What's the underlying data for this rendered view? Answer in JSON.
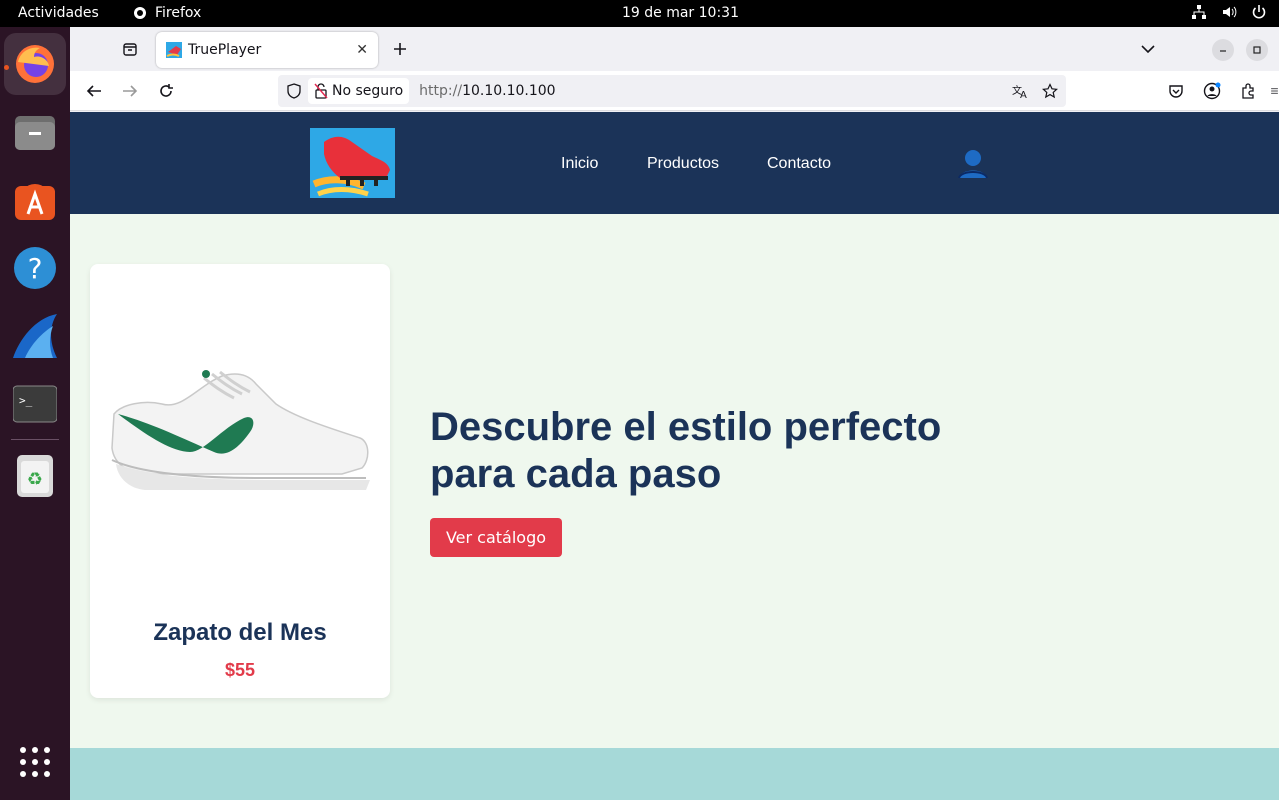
{
  "topbar": {
    "activities": "Actividades",
    "app_name": "Firefox",
    "clock": "19 de mar  10:31"
  },
  "browser": {
    "tab_title": "TruePlayer",
    "url_security": "No seguro",
    "url_protocol": "http://",
    "url_host": "10.10.10.100"
  },
  "site": {
    "nav": [
      "Inicio",
      "Productos",
      "Contacto"
    ],
    "card": {
      "title": "Zapato del Mes",
      "price": "$55"
    },
    "hero": {
      "title": "Descubre el estilo perfecto para cada paso",
      "button": "Ver catálogo"
    }
  },
  "colors": {
    "header_bg": "#1b3358",
    "page_bg": "#eff8ee",
    "accent_red": "#e23b4a",
    "band": "#a6d9d8"
  }
}
